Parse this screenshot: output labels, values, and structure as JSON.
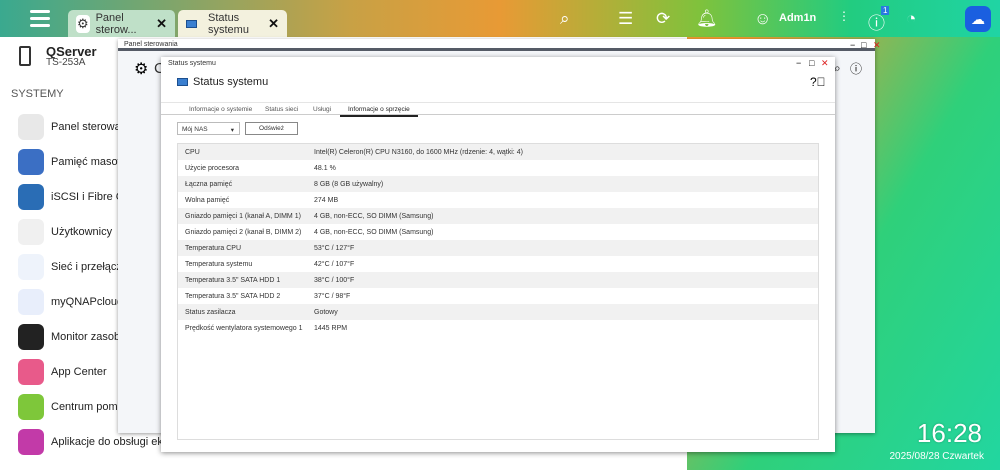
{
  "topbar": {
    "tabs": [
      {
        "label": "Panel sterow...",
        "icon": "gear-icon"
      },
      {
        "label": "Status systemu",
        "icon": "monitor-icon"
      }
    ],
    "user": "Adm1n",
    "notification_count": "1",
    "icons": [
      "search-icon",
      "tasks-icon",
      "sync-icon",
      "bell-icon",
      "user-icon",
      "more-icon",
      "info-icon",
      "dashboard-icon",
      "cloud-icon"
    ]
  },
  "sidebar": {
    "server_name": "QServer",
    "model": "TS-253A",
    "section": "SYSTEMY",
    "apps": [
      {
        "label": "Panel sterowania",
        "color": "#e8e8e8"
      },
      {
        "label": "Pamięć masowa",
        "color": "#3b6fc4"
      },
      {
        "label": "iSCSI i Fibre Cha",
        "color": "#2a6db5"
      },
      {
        "label": "Użytkownicy",
        "color": "#f0f0f0"
      },
      {
        "label": "Sieć i przełączni",
        "color": "#eef3fb"
      },
      {
        "label": "myQNAPcloud",
        "color": "#e8eefb"
      },
      {
        "label": "Monitor zasobów",
        "color": "#222"
      },
      {
        "label": "App Center",
        "color": "#e85a8a"
      },
      {
        "label": "Centrum pomocy",
        "color": "#7ec73a"
      },
      {
        "label": "Aplikacje do obsługi ekr...",
        "color": "#c23aa8"
      }
    ]
  },
  "control_panel": {
    "title": "Panel sterowania",
    "heading_initial": "C"
  },
  "status_window": {
    "title": "Status systemu",
    "heading": "Status systemu",
    "tabs": [
      "Informacje o systemie",
      "Status sieci",
      "Usługi",
      "Informacje o sprzęcie"
    ],
    "active_tab": 3,
    "nas_select": "Mój NAS",
    "refresh_label": "Odśwież",
    "rows": [
      {
        "k": "CPU",
        "v": "Intel(R) Celeron(R) CPU N3160, do 1600 MHz (rdzenie: 4, wątki: 4)"
      },
      {
        "k": "Użycie procesora",
        "v": "48.1 %"
      },
      {
        "k": "Łączna pamięć",
        "v": "8 GB (8 GB używalny)"
      },
      {
        "k": "Wolna pamięć",
        "v": "274 MB"
      },
      {
        "k": "Gniazdo pamięci 1 (kanał A, DIMM 1)",
        "v": "4 GB, non-ECC, SO DIMM (Samsung)"
      },
      {
        "k": "Gniazdo pamięci 2 (kanał B, DIMM 2)",
        "v": "4 GB, non-ECC, SO DIMM (Samsung)"
      },
      {
        "k": "Temperatura CPU",
        "v": "53°C / 127°F"
      },
      {
        "k": "Temperatura systemu",
        "v": "42°C / 107°F"
      },
      {
        "k": "Temperatura 3.5\" SATA HDD 1",
        "v": "38°C / 100°F"
      },
      {
        "k": "Temperatura 3.5\" SATA HDD 2",
        "v": "37°C / 98°F"
      },
      {
        "k": "Status zasilacza",
        "v": "Gotowy"
      },
      {
        "k": "Prędkość wentylatora systemowego 1",
        "v": "1445 RPM"
      }
    ]
  },
  "clock": {
    "time": "16:28",
    "date": "2025/08/28 Czwartek"
  }
}
